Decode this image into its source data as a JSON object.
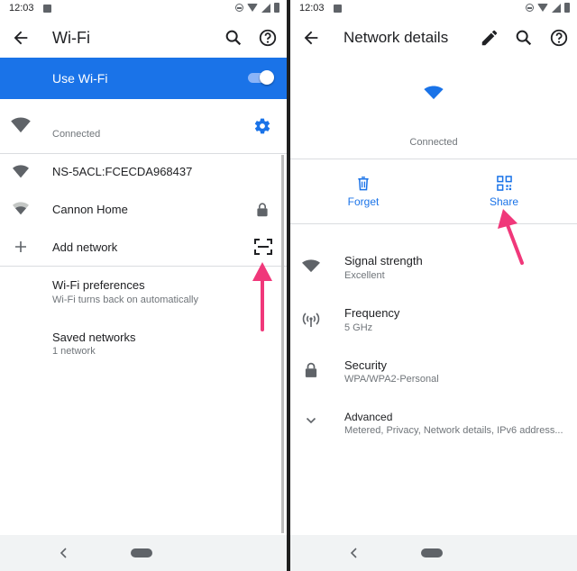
{
  "left": {
    "status": {
      "time": "12:03"
    },
    "title": "Wi-Fi",
    "use_wifi": {
      "label": "Use Wi-Fi",
      "on": true
    },
    "connected_network": {
      "status": "Connected"
    },
    "networks": [
      {
        "name": "NS-5ACL:FCECDA968437",
        "locked": false
      },
      {
        "name": "Cannon Home",
        "locked": true
      }
    ],
    "add_network": {
      "label": "Add network"
    },
    "preferences": {
      "title": "Wi-Fi preferences",
      "subtitle": "Wi-Fi turns back on automatically"
    },
    "saved": {
      "title": "Saved networks",
      "subtitle": "1 network"
    }
  },
  "right": {
    "status": {
      "time": "12:03"
    },
    "title": "Network details",
    "connection_status": "Connected",
    "actions": {
      "forget": "Forget",
      "share": "Share"
    },
    "details": [
      {
        "label": "Signal strength",
        "value": "Excellent",
        "icon": "wifi-icon"
      },
      {
        "label": "Frequency",
        "value": "5 GHz",
        "icon": "antenna-icon"
      },
      {
        "label": "Security",
        "value": "WPA/WPA2-Personal",
        "icon": "lock-icon"
      }
    ],
    "advanced": {
      "label": "Advanced",
      "value": "Metered, Privacy, Network details, IPv6 address..."
    }
  },
  "colors": {
    "accent": "#1a73e8",
    "annotation_arrow": "#f0387a"
  }
}
